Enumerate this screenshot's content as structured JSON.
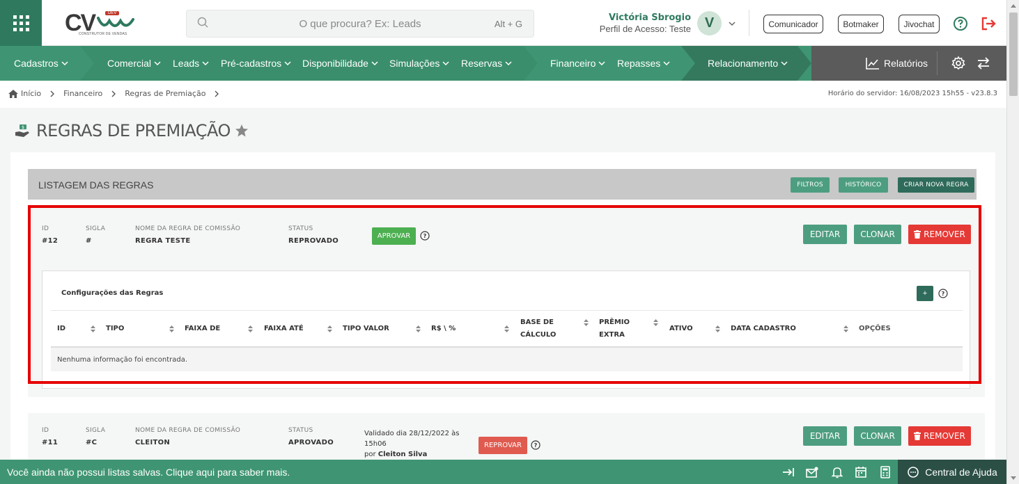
{
  "header": {
    "logo_text": "CV",
    "logo_badge": "DEV",
    "logo_subtitle": "CONSTRUTOR DE VENDAS",
    "search_placeholder": "O que procura? Ex: Leads",
    "search_shortcut": "Alt + G",
    "user_name": "Victória Sbrogio",
    "user_profile": "Perfil de Acesso: Teste",
    "avatar_initial": "V",
    "buttons": [
      "Comunicador",
      "Botmaker",
      "Jivochat"
    ]
  },
  "nav": {
    "items": [
      "Cadastros",
      "Comercial",
      "Leads",
      "Pré-cadastros",
      "Disponibilidade",
      "Simulações",
      "Reservas",
      "Financeiro",
      "Repasses",
      "Relacionamento"
    ],
    "reports": "Relatórios"
  },
  "breadcrumb": {
    "items": [
      "Início",
      "Financeiro",
      "Regras de Premiação"
    ],
    "server_time": "Horário do servidor: 16/08/2023 15h55 - v23.8.3"
  },
  "page": {
    "title": "REGRAS DE PREMIAÇÃO"
  },
  "listing": {
    "title": "LISTAGEM DAS REGRAS",
    "filters_label": "FILTROS",
    "history_label": "HISTÓRICO",
    "create_label": "CRIAR NOVA REGRA"
  },
  "labels": {
    "id": "ID",
    "sigla": "SIGLA",
    "nome": "NOME DA REGRA DE COMISSÃO",
    "status": "STATUS",
    "edit": "EDITAR",
    "clone": "CLONAR",
    "remove": "REMOVER"
  },
  "rules": [
    {
      "id": "#12",
      "sigla": "#",
      "nome": "REGRA TESTE",
      "status": "REPROVADO",
      "action_label": "APROVAR"
    },
    {
      "id": "#11",
      "sigla": "#C",
      "nome": "CLEITON",
      "status": "APROVADO",
      "validated_line1": "Validado dia 28/12/2022 às",
      "validated_line2": "15h06",
      "validated_by_prefix": "por",
      "validated_by": "Cleiton Silva",
      "action_label": "REPROVAR"
    }
  ],
  "config": {
    "title": "Configurações das Regras",
    "plus_label": "+",
    "columns": [
      {
        "line1": "ID",
        "line2": ""
      },
      {
        "line1": "TIPO",
        "line2": ""
      },
      {
        "line1": "FAIXA DE",
        "line2": ""
      },
      {
        "line1": "FAIXA ATÉ",
        "line2": ""
      },
      {
        "line1": "TIPO VALOR",
        "line2": ""
      },
      {
        "line1": "R$ \\ %",
        "line2": ""
      },
      {
        "line1": "BASE DE",
        "line2": "CÁLCULO"
      },
      {
        "line1": "PRÊMIO",
        "line2": "EXTRA"
      },
      {
        "line1": "ATIVO",
        "line2": ""
      },
      {
        "line1": "DATA CADASTRO",
        "line2": ""
      },
      {
        "line1": "OPÇÕES",
        "line2": ""
      }
    ],
    "empty_message": "Nenhuma informação foi encontrada."
  },
  "footer": {
    "message": "Você ainda não possui listas salvas. Clique aqui para saber mais.",
    "help_label": "Central de Ajuda"
  },
  "colors": {
    "brand_green": "#3f9573",
    "dark_green": "#2f6b5a",
    "danger": "#e53935",
    "highlight_red": "#e50000"
  }
}
